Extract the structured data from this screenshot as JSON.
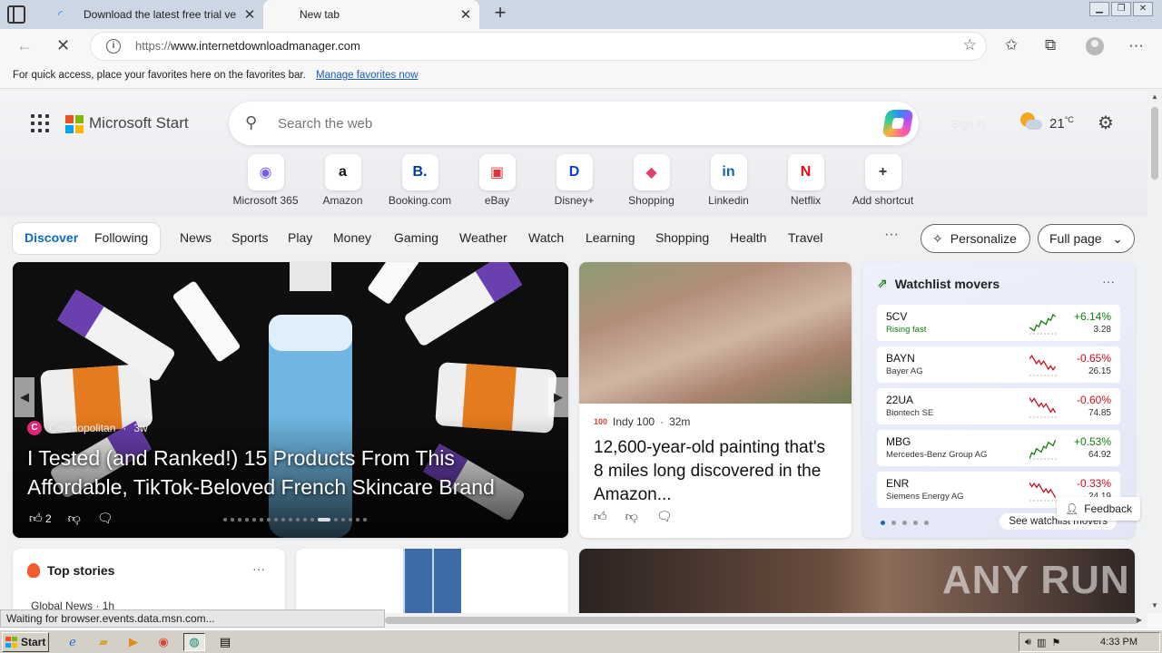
{
  "browser": {
    "tabs": [
      {
        "title": "Download the latest free trial ve",
        "icon": "loading-icon"
      },
      {
        "title": "New tab",
        "icon": "none"
      }
    ],
    "url_scheme": "https://",
    "url_host": "www.internetdownloadmanager.com",
    "favorites_bar": {
      "text": "For quick access, place your favorites here on the favorites bar.",
      "link": "Manage favorites now"
    },
    "status_text": "Waiting for browser.events.data.msn.com..."
  },
  "start_page": {
    "brand": "Microsoft Start",
    "search_placeholder": "Search the web",
    "signin": "Sign in",
    "temperature": "21",
    "temp_unit": "°C",
    "shortcuts": [
      {
        "label": "Microsoft 365",
        "glyph": "◉",
        "color": "#7b5cf0"
      },
      {
        "label": "Amazon",
        "glyph": "a",
        "color": "#111111"
      },
      {
        "label": "Booking.com",
        "glyph": "B.",
        "color": "#003b95"
      },
      {
        "label": "eBay",
        "glyph": "▣",
        "color": "#e53238"
      },
      {
        "label": "Disney+",
        "glyph": "D",
        "color": "#113ccf"
      },
      {
        "label": "Shopping",
        "glyph": "◆",
        "color": "#e0416a"
      },
      {
        "label": "Linkedin",
        "glyph": "in",
        "color": "#0a66c2"
      },
      {
        "label": "Netflix",
        "glyph": "N",
        "color": "#e50914"
      },
      {
        "label": "Add shortcut",
        "glyph": "+",
        "color": "#333333"
      }
    ],
    "nav": {
      "discover": "Discover",
      "following": "Following",
      "categories": [
        "News",
        "Sports",
        "Play",
        "Money",
        "Gaming",
        "Weather",
        "Watch",
        "Learning",
        "Shopping",
        "Health",
        "Travel"
      ],
      "more": "···",
      "personalize": "Personalize",
      "fullpage": "Full page"
    },
    "hero": {
      "source": "Cosmopolitan",
      "age": "3w",
      "headline": "I Tested (and Ranked!) 15 Products From This Affordable, TikTok-Beloved French Skincare Brand",
      "likes": "2"
    },
    "story": {
      "source": "Indy 100",
      "age": "32m",
      "title": "12,600-year-old painting that's 8 miles long discovered in the Amazon..."
    },
    "watchlist": {
      "title": "Watchlist movers",
      "see_all": "See watchlist movers",
      "stocks": [
        {
          "symbol": "5CV",
          "name": "Rising fast",
          "change": "+6.14%",
          "price": "3.28",
          "direction": "up"
        },
        {
          "symbol": "BAYN",
          "name": "Bayer AG",
          "change": "-0.65%",
          "price": "26.15",
          "direction": "down"
        },
        {
          "symbol": "22UA",
          "name": "Biontech SE",
          "change": "-0.60%",
          "price": "74.85",
          "direction": "down"
        },
        {
          "symbol": "MBG",
          "name": "Mercedes-Benz Group AG",
          "change": "+0.53%",
          "price": "64.92",
          "direction": "up"
        },
        {
          "symbol": "ENR",
          "name": "Siemens Energy AG",
          "change": "-0.33%",
          "price": "24.19",
          "direction": "down"
        }
      ]
    },
    "top_stories": {
      "title": "Top stories",
      "first_source": "Global News",
      "first_age": "1h"
    },
    "feedback": "Feedback"
  },
  "taskbar": {
    "start_label": "Start",
    "clock": "4:33 PM"
  },
  "colors": {
    "accent": "#0f6cbd",
    "up": "#107c10",
    "down": "#c50f1f"
  },
  "watermark": "ANY RUN"
}
